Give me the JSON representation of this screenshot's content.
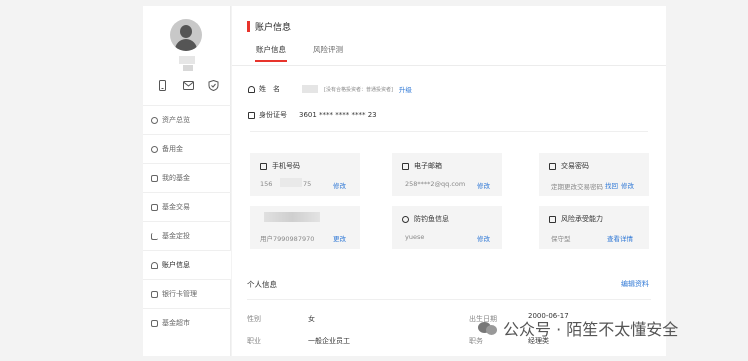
{
  "sidebar": {
    "items": [
      {
        "label": "资产总览"
      },
      {
        "label": "备用金"
      },
      {
        "label": "我的基金"
      },
      {
        "label": "基金交易"
      },
      {
        "label": "基金定投"
      },
      {
        "label": "账户信息"
      },
      {
        "label": "银行卡管理"
      },
      {
        "label": "基金超市"
      }
    ]
  },
  "main": {
    "title": "账户信息",
    "tabs": [
      {
        "label": "账户信息"
      },
      {
        "label": "风险评测"
      }
    ],
    "name_label": "姓　名",
    "name_note": "[没有合格投资者：普通投资者]",
    "upgrade": "升级",
    "id_label": "身份证号",
    "id_value": "3601 **** **** **** 23",
    "cards": {
      "phone": {
        "title": "手机号码",
        "value_prefix": "156",
        "value_suffix": "75",
        "action": "修改"
      },
      "email": {
        "title": "电子邮箱",
        "value": "258****2@qq.com",
        "action": "修改"
      },
      "trade_pwd": {
        "title": "交易密码",
        "note": "定期更改交易密码",
        "action1": "找回",
        "action2": "修改"
      },
      "user": {
        "value": "用户7990987970",
        "action": "更改"
      },
      "security": {
        "title": "防钓鱼信息",
        "value": "yuese",
        "action": "修改"
      },
      "risk": {
        "title": "风险承受能力",
        "value": "保守型",
        "action": "查看详情"
      }
    },
    "personal": {
      "title": "个人信息",
      "edit": "编辑资料",
      "gender_label": "性别",
      "gender": "女",
      "birth_label": "出生日期",
      "birth": "2000-06-17",
      "job_label": "职业",
      "job": "一般企业员工",
      "role_label": "职务",
      "role": "经理类"
    }
  },
  "watermark": "公众号 · 陌笙不太懂安全"
}
